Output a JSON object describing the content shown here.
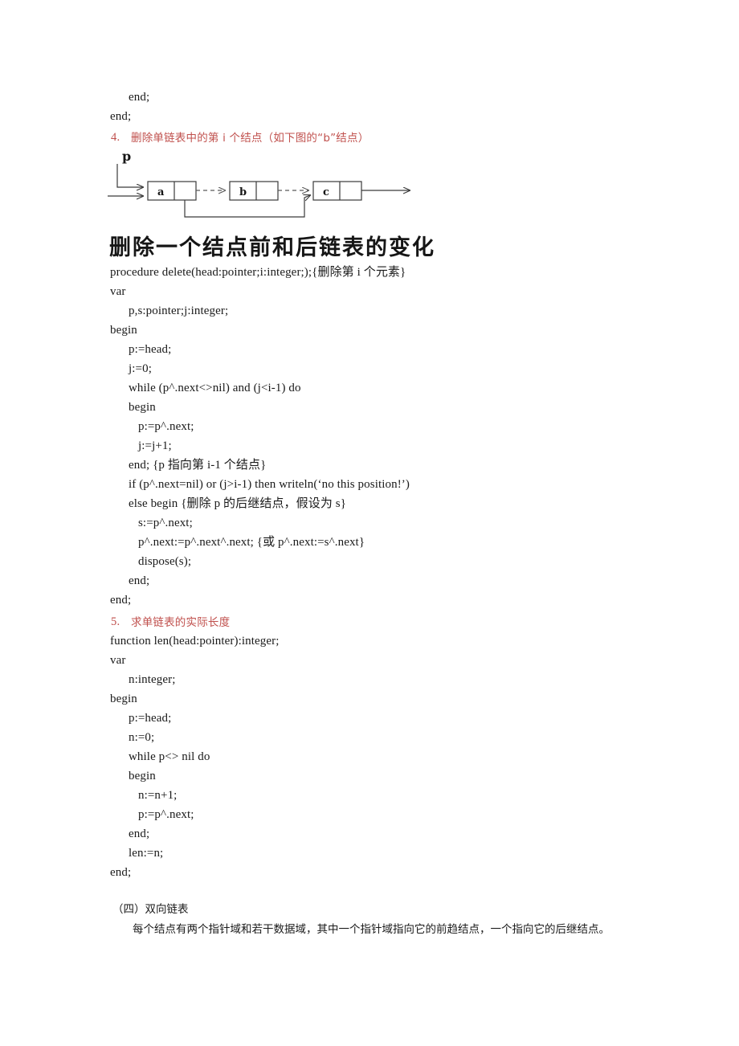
{
  "document": {
    "language": "zh-CN",
    "page_background": "#ffffff",
    "accent_heading_color": "#c0504d"
  },
  "top_code_tail": [
    {
      "text": "end;",
      "indent": 1
    },
    {
      "text": "end;",
      "indent": 0
    }
  ],
  "section4": {
    "number": "4.",
    "title": "删除单链表中的第 i 个结点（如下图的“b”结点）",
    "color": "#c0504d"
  },
  "diagram": {
    "name": "singly-linked-list-deletion-diagram",
    "pointer_label": "p",
    "nodes": [
      {
        "label": "a"
      },
      {
        "label": "b"
      },
      {
        "label": "c"
      }
    ],
    "dashed_links": [
      {
        "from": "a",
        "to": "b"
      },
      {
        "from": "b",
        "to": "c"
      }
    ],
    "bypass_link": {
      "from": "a",
      "to": "c",
      "style": "solid"
    },
    "caption": "删除一个结点前和后链表的变化"
  },
  "delete_procedure": [
    {
      "text": "procedure delete(head:pointer;i:integer;);{删除第 i 个元素}",
      "indent": 0
    },
    {
      "text": "var",
      "indent": 0
    },
    {
      "text": "p,s:pointer;j:integer;",
      "indent": 1
    },
    {
      "text": "begin",
      "indent": 0
    },
    {
      "text": "p:=head;",
      "indent": 1
    },
    {
      "text": "j:=0;",
      "indent": 1
    },
    {
      "text": "while (p^.next<>nil) and (j<i-1) do",
      "indent": 1
    },
    {
      "text": "begin",
      "indent": 1
    },
    {
      "text": "p:=p^.next;",
      "indent": 2
    },
    {
      "text": "j:=j+1;",
      "indent": 2
    },
    {
      "text": "end; {p 指向第 i-1 个结点}",
      "indent": 1
    },
    {
      "text": "if (p^.next=nil) or (j>i-1) then writeln(‘no this position!’)",
      "indent": 1
    },
    {
      "text": "else begin {删除 p 的后继结点，假设为 s}",
      "indent": 1
    },
    {
      "text": "s:=p^.next;",
      "indent": 2
    },
    {
      "text": "p^.next:=p^.next^.next; {或 p^.next:=s^.next}",
      "indent": 2
    },
    {
      "text": "dispose(s);",
      "indent": 2
    },
    {
      "text": "end;",
      "indent": 1
    },
    {
      "text": "end;",
      "indent": 0
    }
  ],
  "section5": {
    "number": "5.",
    "title": "求单链表的实际长度",
    "color": "#c0504d"
  },
  "len_function": [
    {
      "text": "function len(head:pointer):integer;",
      "indent": 0
    },
    {
      "text": "var",
      "indent": 0
    },
    {
      "text": "n:integer;",
      "indent": 1
    },
    {
      "text": "begin",
      "indent": 0
    },
    {
      "text": "p:=head;",
      "indent": 1
    },
    {
      "text": "n:=0;",
      "indent": 1
    },
    {
      "text": "while p<> nil do",
      "indent": 1
    },
    {
      "text": "begin",
      "indent": 1
    },
    {
      "text": "n:=n+1;",
      "indent": 2
    },
    {
      "text": "p:=p^.next;",
      "indent": 2
    },
    {
      "text": "end;",
      "indent": 1
    },
    {
      "text": "len:=n;",
      "indent": 1
    },
    {
      "text": "end;",
      "indent": 0
    }
  ],
  "section_four": {
    "heading": "（四）双向链表",
    "body": "每个结点有两个指针域和若干数据域，其中一个指针域指向它的前趋结点，一个指向它的后继结点。"
  }
}
